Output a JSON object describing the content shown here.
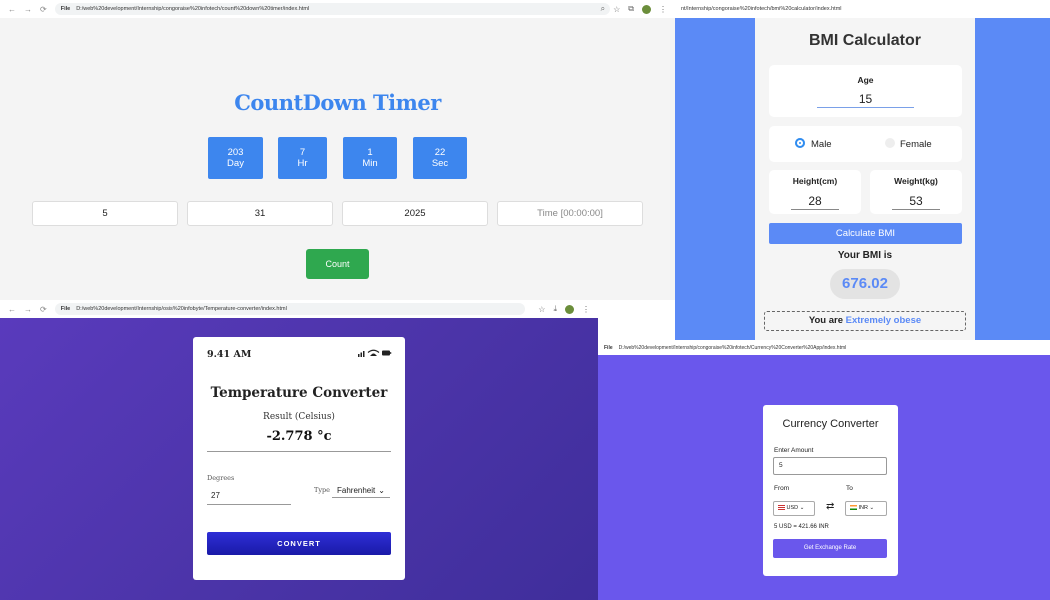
{
  "countdown": {
    "url": "D:/web%20development/Internship/congoraise%20infotech/count%20down%20timer/index.html",
    "title": "CountDown Timer",
    "boxes": [
      {
        "value": "203",
        "unit": "Day"
      },
      {
        "value": "7",
        "unit": "Hr"
      },
      {
        "value": "1",
        "unit": "Min"
      },
      {
        "value": "22",
        "unit": "Sec"
      }
    ],
    "inputs": {
      "month": "5",
      "day": "31",
      "year": "2025",
      "time_placeholder": "Time [00:00:00]"
    },
    "count_label": "Count"
  },
  "bmi": {
    "url": "nt/Internship/congoraise%20infotech/bmi%20calculator/index.html",
    "title": "BMI Calculator",
    "age_label": "Age",
    "age_value": "15",
    "male_label": "Male",
    "female_label": "Female",
    "height_label": "Height(cm)",
    "height_value": "28",
    "weight_label": "Weight(kg)",
    "weight_value": "53",
    "calc_label": "Calculate BMI",
    "your_bmi_label": "Your BMI is",
    "result": "676.02",
    "status_prefix": "You are",
    "status_value": "Extremely obese"
  },
  "temperature": {
    "url": "D:/web%20development/Internship/osis%20infobyte/Temperature-converter/index.html",
    "time": "9.41 AM",
    "title": "Temperature Converter",
    "result_label": "Result (Celsius)",
    "result_value": "-2.778 °c",
    "degrees_label": "Degrees",
    "degrees_value": "27",
    "type_label": "Type",
    "type_value": "Fahrenheit",
    "convert_label": "CONVERT"
  },
  "currency": {
    "url": "D:/web%20development/Internship/congoraise%20infotech/Currency%20Converter%20App/index.html",
    "title": "Currency Converter",
    "amount_label": "Enter Amount",
    "amount_value": "5",
    "from_label": "From",
    "to_label": "To",
    "from_value": "USD",
    "to_value": "INR",
    "rate_text": "5 USD = 421.66 INR",
    "button_label": "Get Exchange Rate"
  },
  "browser": {
    "file_label": "File"
  }
}
